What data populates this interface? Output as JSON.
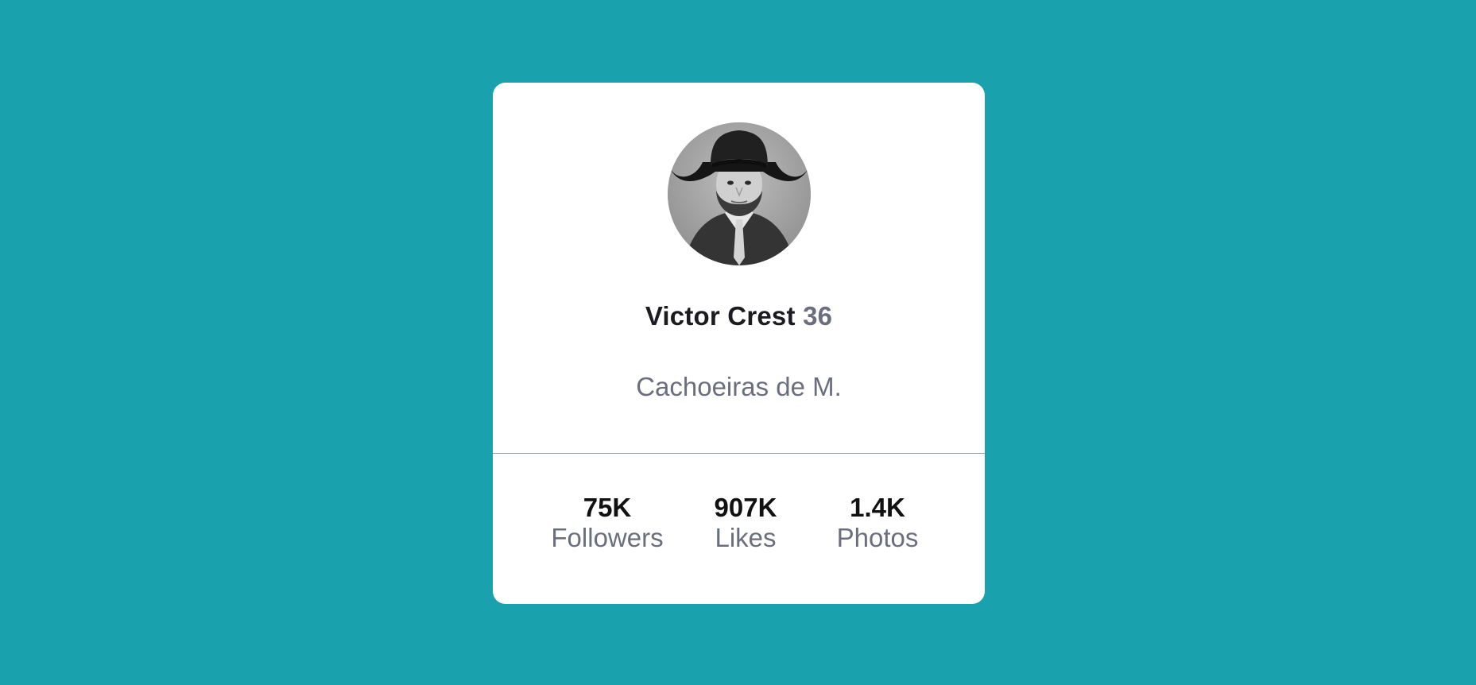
{
  "colors": {
    "background": "#19a2ae",
    "card": "#ffffff",
    "name_text": "#1b1b20",
    "muted_text": "#6b6f7d",
    "divider": "#9aa0aa"
  },
  "profile": {
    "avatar_icon": "profile-photo-avatar",
    "name": "Victor Crest",
    "age": "36",
    "location": "Cachoeiras de M."
  },
  "stats": [
    {
      "value": "75K",
      "label": "Followers"
    },
    {
      "value": "907K",
      "label": "Likes"
    },
    {
      "value": "1.4K",
      "label": "Photos"
    }
  ]
}
